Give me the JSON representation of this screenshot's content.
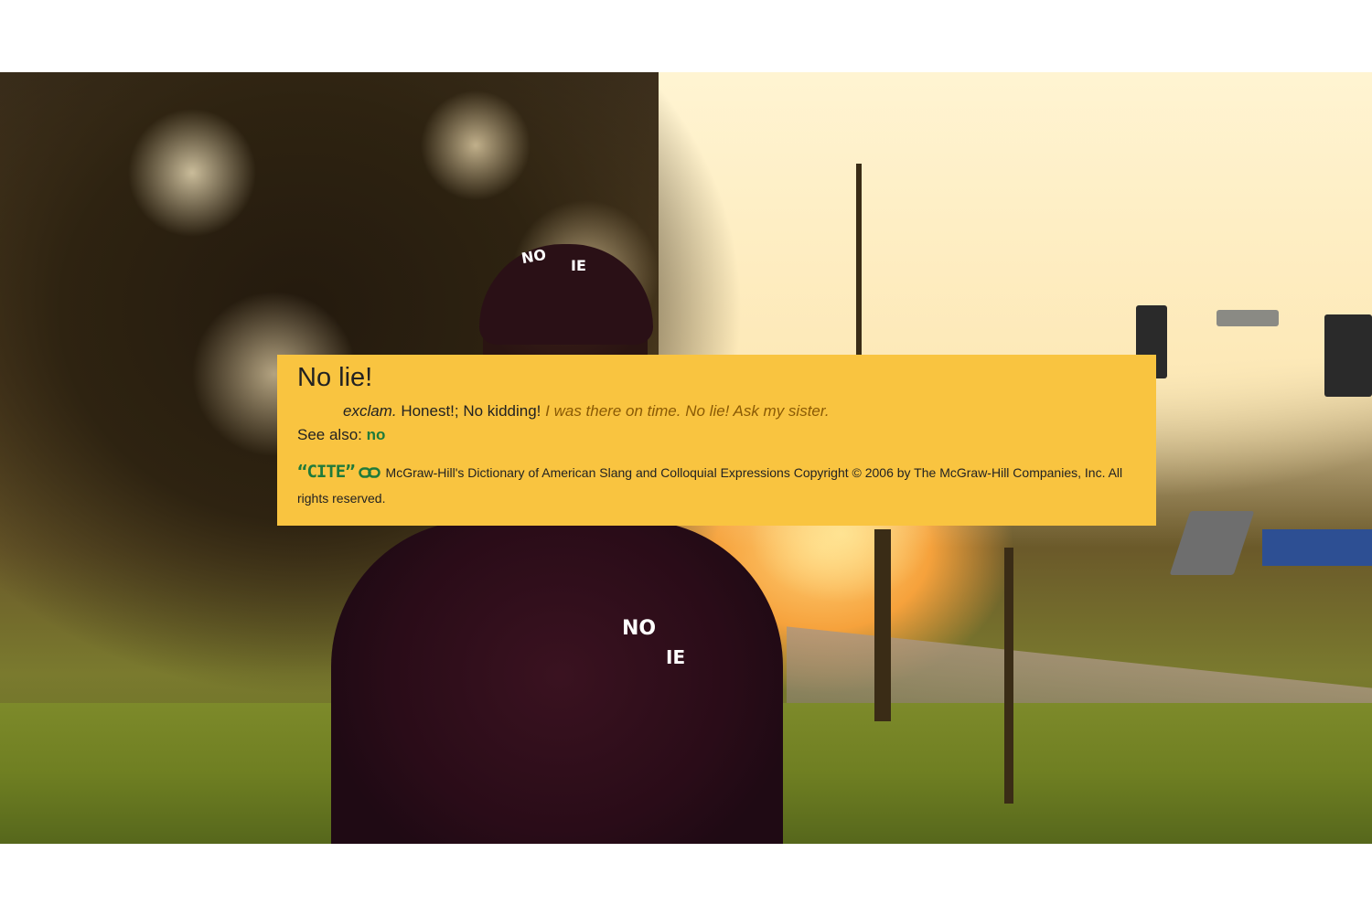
{
  "entry": {
    "headword": "No lie!",
    "pos": "exclam.",
    "definition": "Honest!; No kidding!",
    "example": "I was there on time. No lie! Ask my sister.",
    "see_also_label": "See also:",
    "see_also_link": "no"
  },
  "citation": {
    "cite_label": "“CITE”",
    "source": "McGraw-Hill's Dictionary of American Slang and Colloquial Expressions Copyright © 2006 by The McGraw-Hill Companies, Inc. All rights reserved."
  },
  "photo": {
    "cap_logo_left": "NO",
    "cap_logo_right": "IE",
    "shirt_logo_left": "NO",
    "shirt_logo_right": "IE"
  },
  "colors": {
    "popup_background": "#f9c440",
    "link_green": "#1f7a3a",
    "example_brown": "#8a5a05"
  }
}
